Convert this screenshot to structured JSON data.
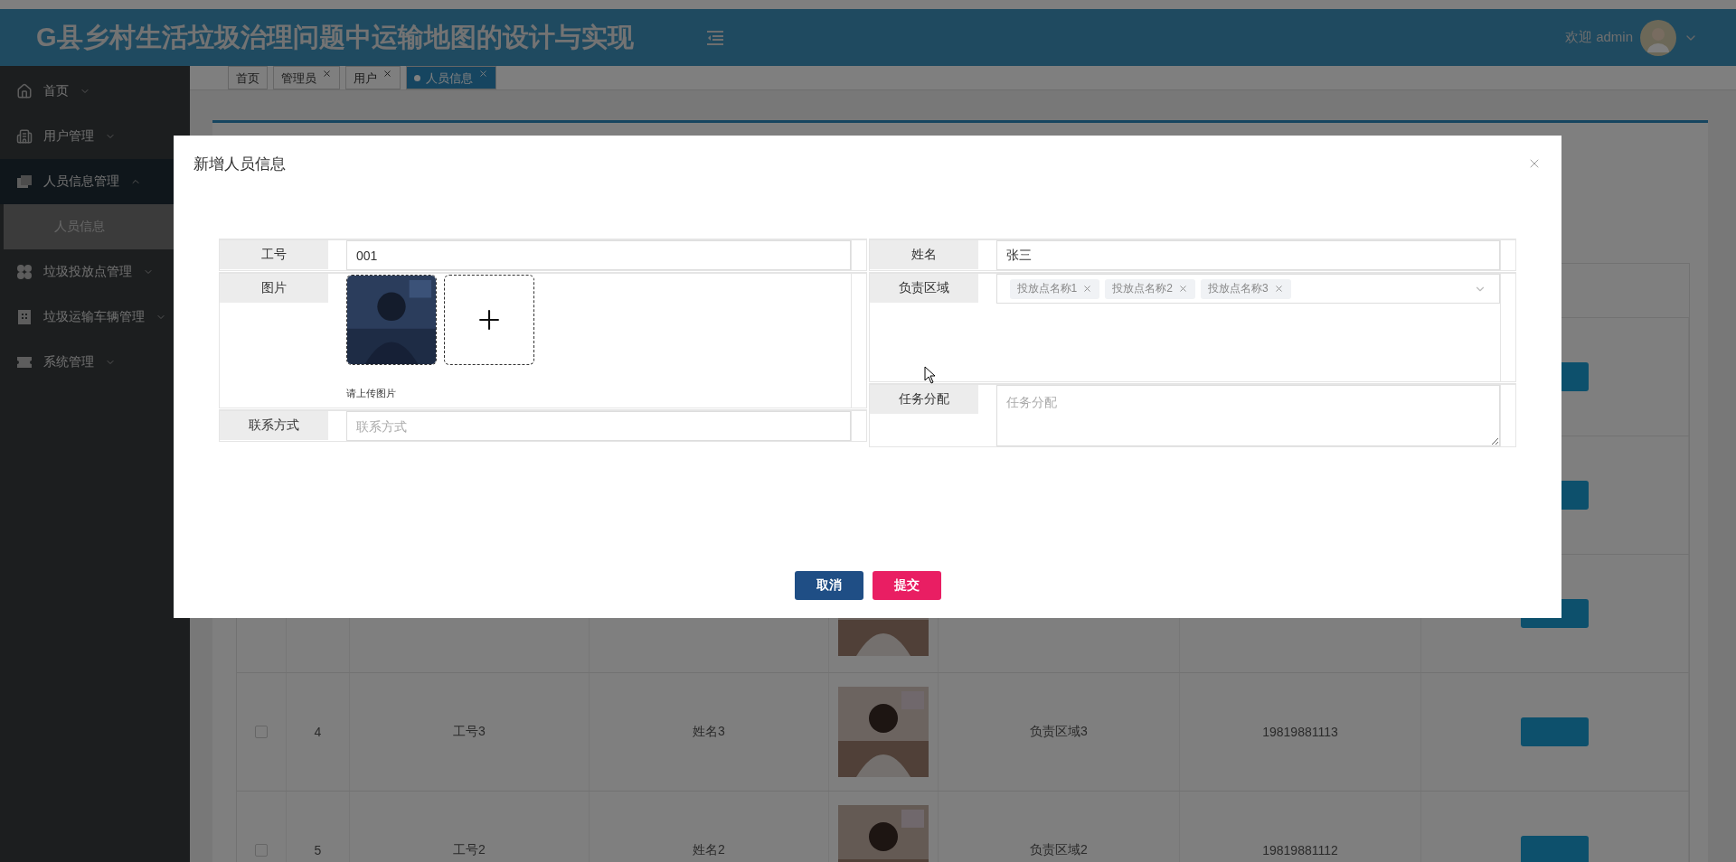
{
  "header": {
    "title": "G县乡村生活垃圾治理问题中运输地图的设计与实现",
    "greeting": "欢迎 admin"
  },
  "sidebar": {
    "items": [
      {
        "label": "首页",
        "expanded": false
      },
      {
        "label": "用户管理",
        "expanded": false
      },
      {
        "label": "人员信息管理",
        "expanded": true,
        "children": [
          {
            "label": "人员信息",
            "selected": true
          }
        ]
      },
      {
        "label": "垃圾投放点管理",
        "expanded": false
      },
      {
        "label": "垃圾运输车辆管理",
        "expanded": false
      },
      {
        "label": "系统管理",
        "expanded": false
      }
    ]
  },
  "tabs": [
    {
      "label": "首页",
      "closable": false,
      "selected": false
    },
    {
      "label": "管理员",
      "closable": true,
      "selected": false
    },
    {
      "label": "用户",
      "closable": true,
      "selected": false
    },
    {
      "label": "人员信息",
      "closable": true,
      "selected": true
    }
  ],
  "table": {
    "rows": [
      {
        "kind": "covered"
      },
      {
        "kind": "covered"
      },
      {
        "kind": "partial"
      },
      {
        "kind": "full",
        "checked": false,
        "number": "4",
        "id": "工号3",
        "name": "姓名3",
        "area": "负责区域3",
        "phone": "19819881113"
      },
      {
        "kind": "full",
        "checked": false,
        "number": "5",
        "id": "工号2",
        "name": "姓名2",
        "area": "负责区域2",
        "phone": "19819881112"
      }
    ]
  },
  "modal": {
    "title": "新增人员信息",
    "left": [
      {
        "kind": "input",
        "label": "工号",
        "value": "001"
      },
      {
        "kind": "upload",
        "label": "图片",
        "hint": "请上传图片"
      },
      {
        "kind": "input",
        "label": "联系方式",
        "placeholder": "联系方式"
      }
    ],
    "right": [
      {
        "kind": "input",
        "label": "姓名",
        "value": "张三"
      },
      {
        "kind": "multiselect",
        "label": "负责区域",
        "tags": [
          "投放点名称1",
          "投放点名称2",
          "投放点名称3"
        ]
      },
      {
        "kind": "textarea",
        "label": "任务分配",
        "placeholder": "任务分配"
      }
    ],
    "buttons": [
      {
        "kind": "cancel",
        "label": "取消"
      },
      {
        "kind": "submit",
        "label": "提交"
      }
    ]
  }
}
